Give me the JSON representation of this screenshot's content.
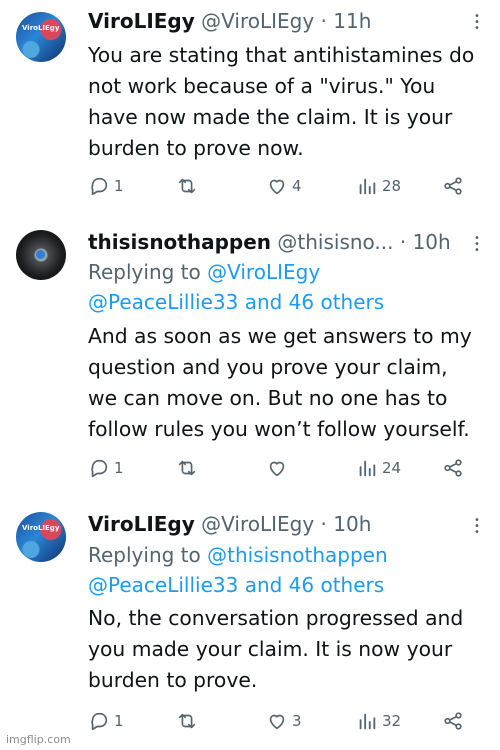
{
  "tweets": [
    {
      "avatar_text": "ViroLIEgy",
      "name": "ViroLIEgy",
      "handle": "@ViroLIEgy",
      "sep": "·",
      "time": "11h",
      "replying_prefix": "",
      "replying_links": "",
      "replying_others": "",
      "lines": [
        "You are stating that antihistamines do",
        "not work because of a \"virus.\" You",
        "have now made the claim.  It is your",
        "burden to prove now."
      ],
      "replies": "1",
      "retweets": "",
      "likes": "4",
      "views": "28"
    },
    {
      "name": "thisisnothappen",
      "handle": "@thisisno...",
      "sep": "·",
      "time": "10h",
      "replying_prefix": "Replying to ",
      "replying_first": "@ViroLIEgy",
      "replying_second": "@PeaceLillie33 and 46 others",
      "lines": [
        "And as soon as we get answers to my",
        "question and you prove your claim,",
        "we can move on. But no one has to",
        "follow rules you won’t follow yourself."
      ],
      "replies": "1",
      "retweets": "",
      "likes": "",
      "views": "24"
    },
    {
      "avatar_text": "ViroLIEgy",
      "name": "ViroLIEgy",
      "handle": "@ViroLIEgy",
      "sep": "·",
      "time": "10h",
      "replying_prefix": "Replying to ",
      "replying_first": "@thisisnothappen",
      "replying_second": "@PeaceLillie33 and 46 others",
      "lines": [
        "No, the conversation progressed and",
        "you made your claim. It is now your",
        "burden to prove."
      ],
      "replies": "1",
      "retweets": "",
      "likes": "3",
      "views": "32"
    }
  ],
  "watermark": "imgflip.com",
  "colors": {
    "text": "#0f1419",
    "muted": "#536471",
    "link": "#1d9bf0",
    "thread_line": "#cfd9de"
  },
  "icons": {
    "reply": "reply-icon",
    "retweet": "retweet-icon",
    "like": "heart-icon",
    "views": "views-icon",
    "share": "share-icon",
    "more": "more-icon"
  }
}
